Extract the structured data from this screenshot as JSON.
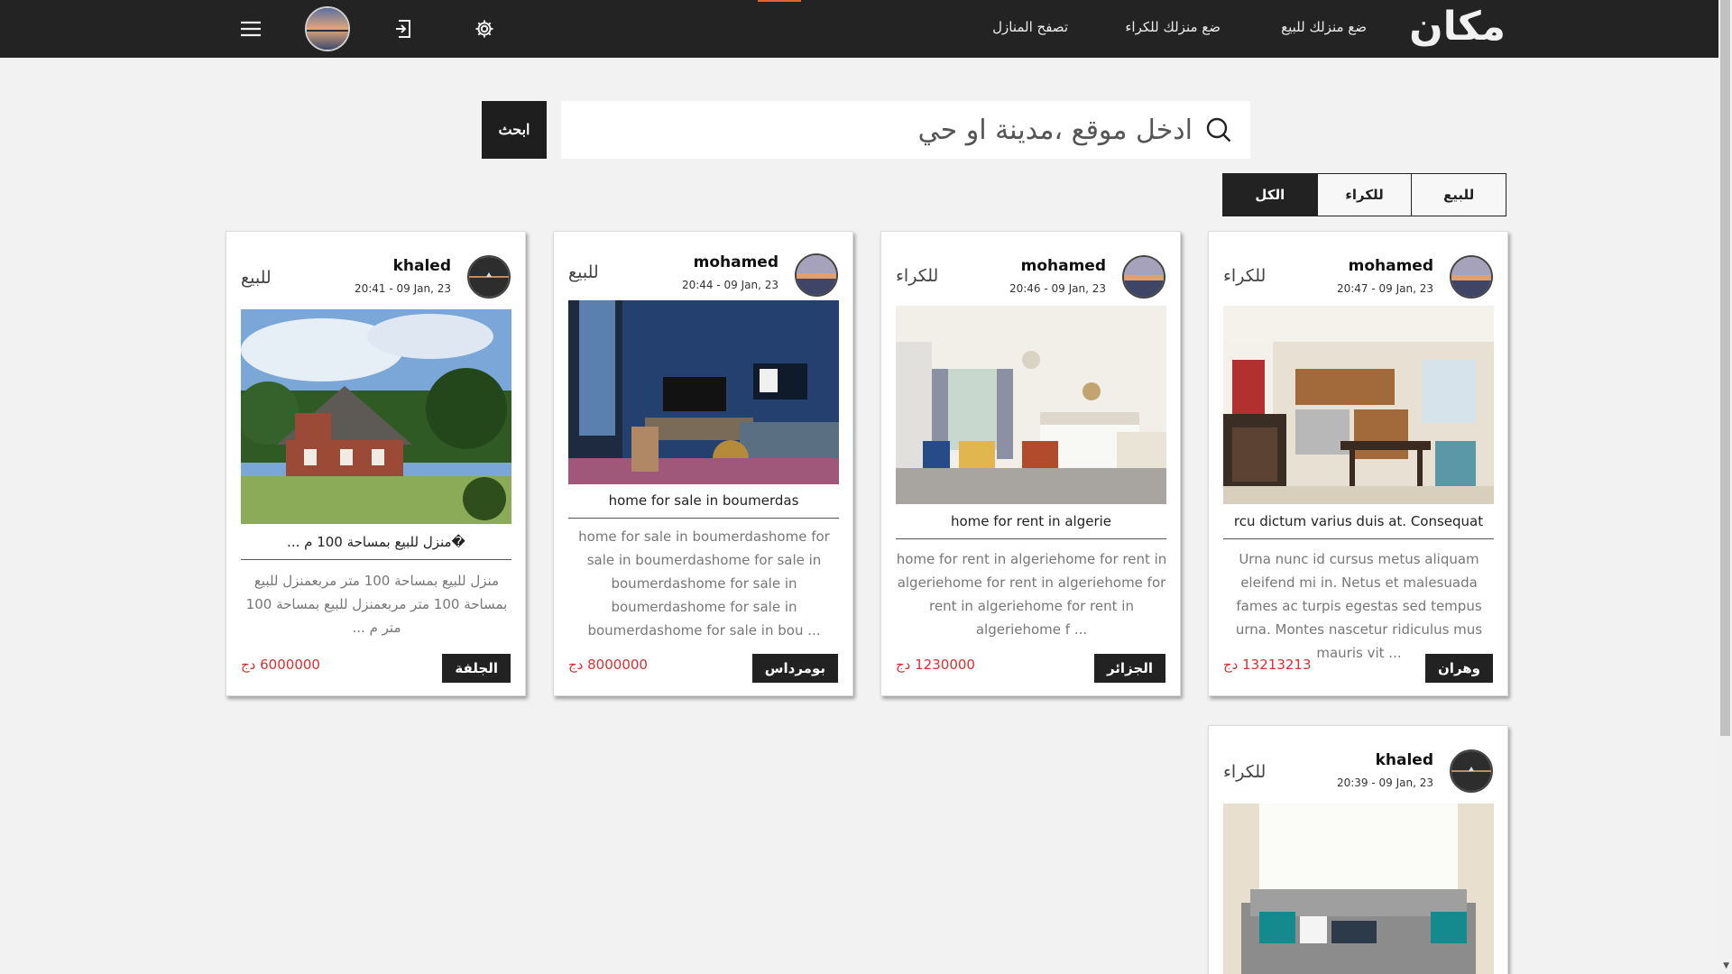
{
  "nav": {
    "logo": "مكان",
    "sale_link": "ضع منزلك للبيع",
    "rent_link": "ضع منزلك للكراء",
    "browse_link": "تصفح المنازل"
  },
  "search": {
    "placeholder": "ادخل موقع ،مدينة او حي",
    "button": "ابحث"
  },
  "filters": {
    "tabs": [
      "للبيع",
      "للكراء",
      "الكل"
    ],
    "active": "الكل"
  },
  "colors": {
    "nav_bg": "#232323",
    "price": "#d93030",
    "accent": "#e0663a"
  },
  "listings": [
    {
      "user": "mohamed",
      "date": "20:47 - 09 Jan, 23",
      "type": "للكراء",
      "title": "rcu dictum varius duis at. Consequat",
      "description": "Urna nunc id cursus metus aliquam eleifend mi in. Netus et malesuada fames ac turpis egestas sed tempus urna. Montes nascetur ridiculus mus mauris vit ...",
      "price": "13213213 دج",
      "city": "وهران"
    },
    {
      "user": "mohamed",
      "date": "20:46 - 09 Jan, 23",
      "type": "للكراء",
      "title": "home for rent in algerie",
      "description": "home for rent in algeriehome for rent in algeriehome for rent in algeriehome for rent in algeriehome for rent in algeriehome f ...",
      "price": "1230000 دج",
      "city": "الجزائر"
    },
    {
      "user": "mohamed",
      "date": "20:44 - 09 Jan, 23",
      "type": "للبيع",
      "title": "home for sale in boumerdas",
      "description": "home for sale in boumerdashome for sale in boumerdashome for sale in boumerdashome for sale in boumerdashome for sale in boumerdashome for sale in bou ...",
      "price": "8000000 دج",
      "city": "بومرداس"
    },
    {
      "user": "khaled",
      "date": "20:41 - 09 Jan, 23",
      "type": "للبيع",
      "title": "�منزل للبيع بمساحة 100 م ...",
      "description": "منزل للبيع بمساحة 100 متر مربعمنزل للبيع بمساحة 100 متر مربعمنزل للبيع بمساحة 100 متر م ...",
      "price": "6000000 دج",
      "city": "الجلفة"
    },
    {
      "user": "khaled",
      "date": "20:39 - 09 Jan, 23",
      "type": "للكراء",
      "title": "",
      "description": "",
      "price": "",
      "city": ""
    }
  ]
}
